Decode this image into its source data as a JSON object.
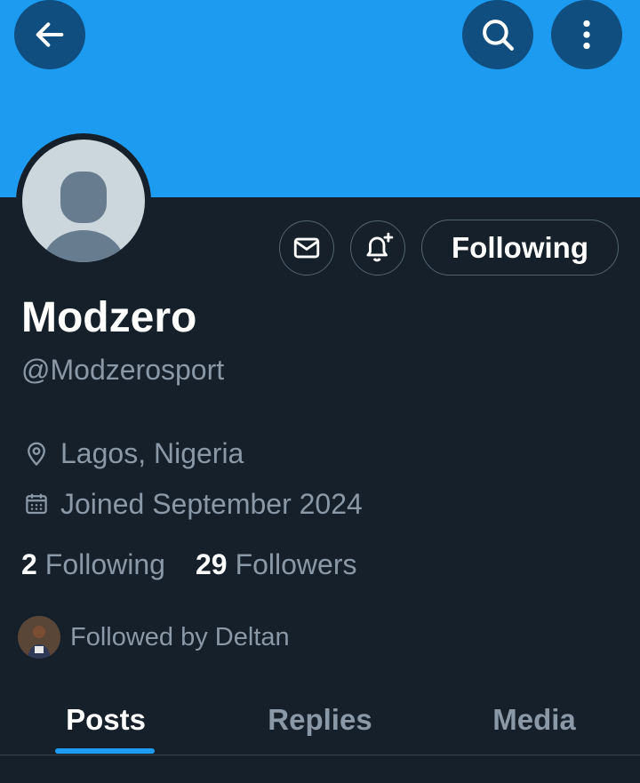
{
  "header": {
    "back_icon": "arrow-left-icon",
    "search_icon": "search-icon",
    "more_icon": "more-vertical-icon"
  },
  "colors": {
    "banner": "#1d9bf0",
    "background": "#15202b",
    "accent": "#1d9bf0",
    "secondary_text": "#8b98a5"
  },
  "actions": {
    "message_icon": "mail-icon",
    "notify_icon": "bell-plus-icon",
    "follow_label": "Following"
  },
  "profile": {
    "display_name": "Modzero",
    "handle": "@Modzerosport",
    "location": "Lagos, Nigeria",
    "joined": "Joined September 2024",
    "following_count": "2",
    "following_label": "Following",
    "followers_count": "29",
    "followers_label": "Followers",
    "followed_by": "Followed by Deltan"
  },
  "tabs": [
    {
      "label": "Posts",
      "active": true
    },
    {
      "label": "Replies",
      "active": false
    },
    {
      "label": "Media",
      "active": false
    }
  ]
}
